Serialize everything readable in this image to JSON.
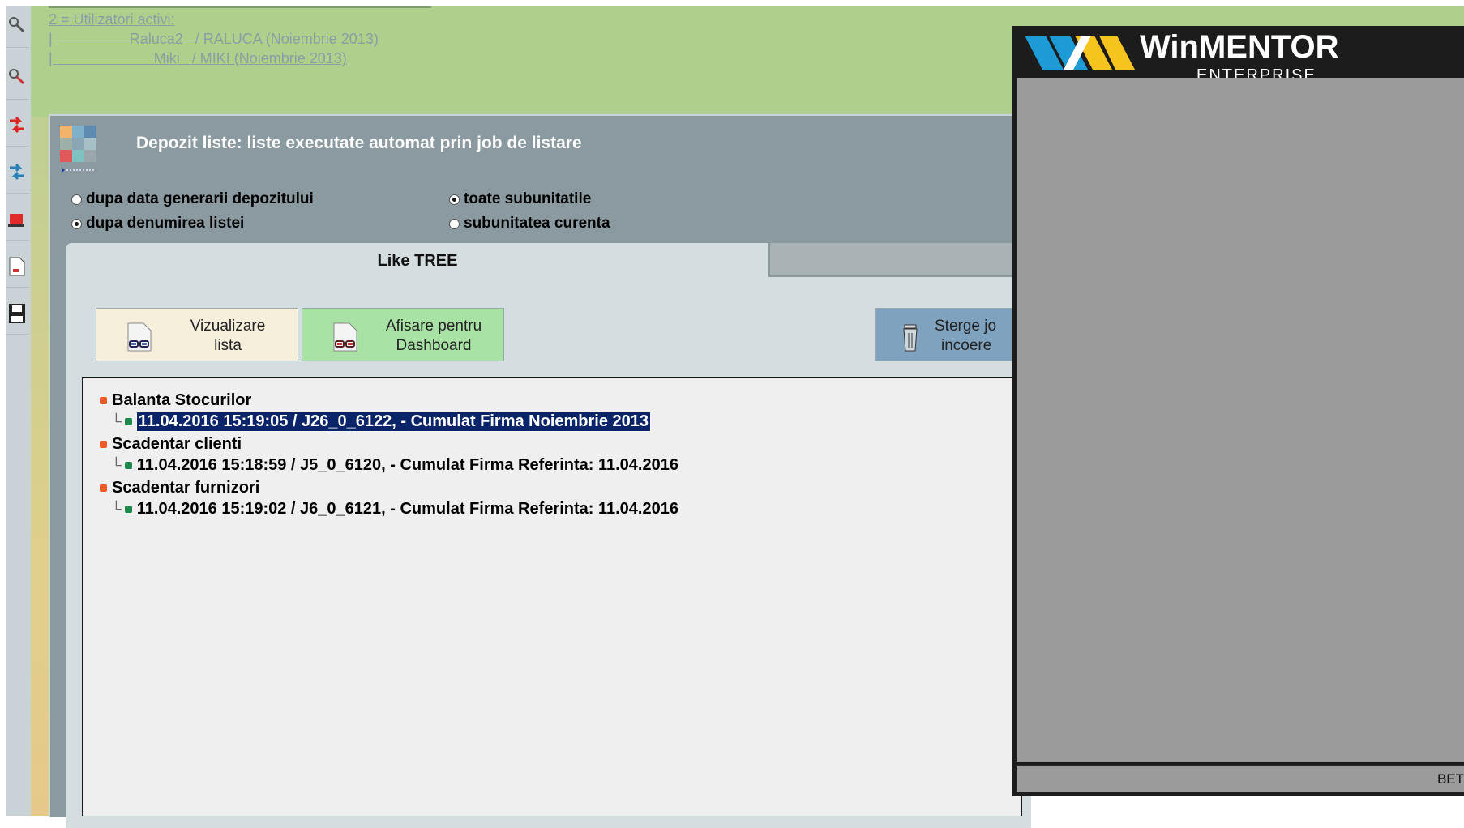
{
  "users_header": {
    "title": "2 = Utilizatori activi:",
    "users": [
      "|                   Raluca2   / RALUCA (Noiembrie 2013)",
      "|                         Miki   / MIKI (Noiembrie 2013)"
    ]
  },
  "window": {
    "title": "Depozit liste: liste executate automat prin job de listare"
  },
  "options": {
    "sort_by_date": "dupa data generarii depozitului",
    "sort_by_name": "dupa denumirea listei",
    "all_subunits": "toate subunitatile",
    "current_subunit": "subunitatea curenta",
    "selected_sort": "dupa denumirea listei",
    "selected_scope": "toate subunitatile"
  },
  "tabs": {
    "active": "Like TREE"
  },
  "buttons": {
    "view_line1": "Vizualizare",
    "view_line2": "lista",
    "dashboard_line1": "Afisare pentru",
    "dashboard_line2": "Dashboard",
    "delete_line1": "Sterge jo",
    "delete_line2": "incoere"
  },
  "tree": [
    {
      "label": "Balanta Stocurilor",
      "child": "11.04.2016 15:19:05 / J26_0_6122,  - Cumulat Firma  Noiembrie 2013",
      "selected": true
    },
    {
      "label": "Scadentar clienti",
      "child": "11.04.2016 15:18:59 / J5_0_6120,  - Cumulat Firma Referinta: 11.04.2016",
      "selected": false
    },
    {
      "label": "Scadentar furnizori",
      "child": "11.04.2016 15:19:02 / J6_0_6121,  - Cumulat Firma Referinta: 11.04.2016",
      "selected": false
    }
  ],
  "splash": {
    "brand_win": "Win",
    "brand_mentor": "MENTOR",
    "brand_sub": "ENTERPRISE",
    "status": "BET"
  },
  "colors": {
    "top_area": "#aed08c",
    "window_bg": "#8a9aa0",
    "selection": "#0a246a",
    "node_red": "#ee5a28",
    "node_green": "#1d8a4c",
    "logo_blue": "#1c9bd7",
    "logo_yellow": "#f5c51e"
  }
}
